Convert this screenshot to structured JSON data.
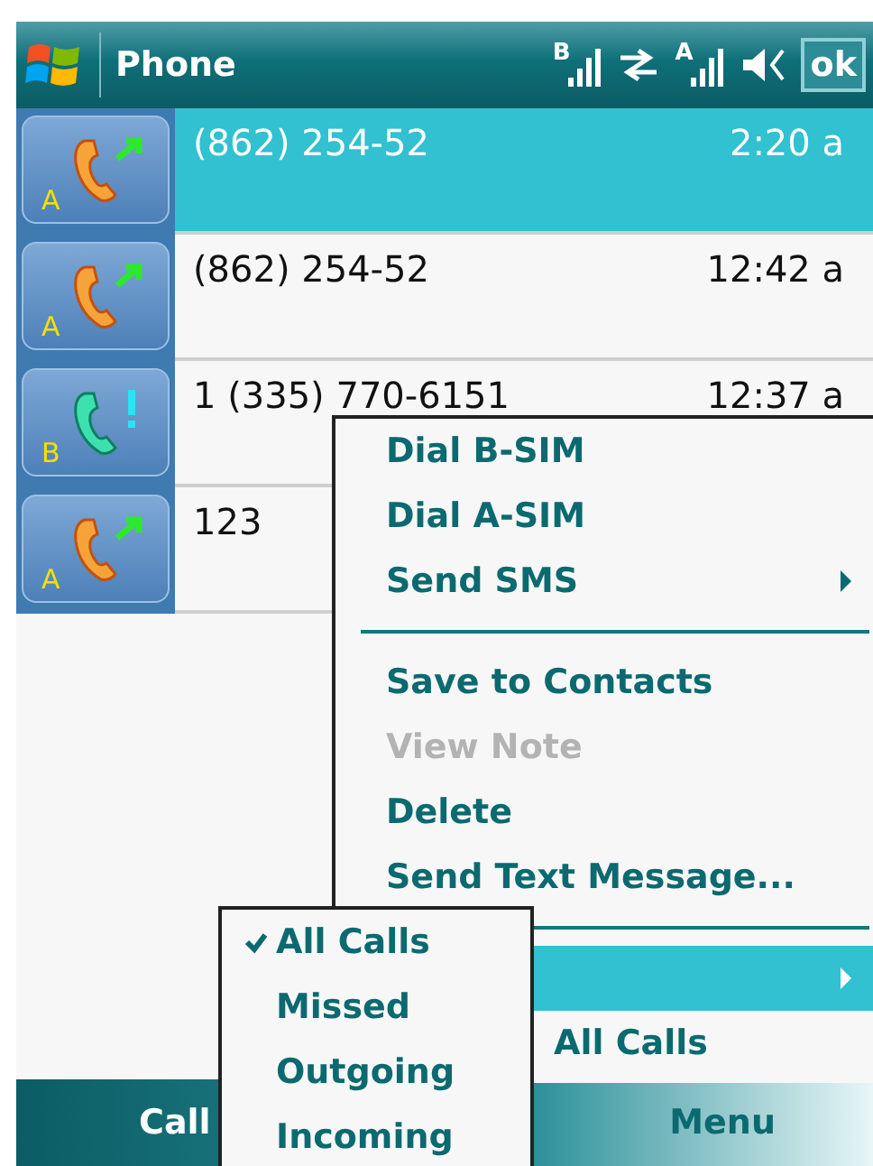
{
  "title_bar": {
    "title": "Phone",
    "signal_b_label": "B",
    "signal_a_label": "A",
    "ok_button": "ok"
  },
  "calls": [
    {
      "number": "(862) 254-52",
      "time": "2:20 a",
      "kind": "outgoing",
      "sim": "A",
      "selected": true
    },
    {
      "number": "(862) 254-52",
      "time": "12:42 a",
      "kind": "outgoing",
      "sim": "A",
      "selected": false
    },
    {
      "number": "1 (335) 770-6151",
      "time": "12:37 a",
      "kind": "missed",
      "sim": "B",
      "selected": false
    },
    {
      "number": "123",
      "kind": "outgoing",
      "sim": "A",
      "selected": false
    }
  ],
  "context_menu": [
    {
      "kind": "item",
      "label": "Dial B-SIM",
      "disabled": false,
      "selected": false,
      "submenu": false
    },
    {
      "kind": "item",
      "label": "Dial A-SIM",
      "disabled": false,
      "selected": false,
      "submenu": false
    },
    {
      "kind": "item",
      "label": "Send SMS",
      "disabled": false,
      "selected": false,
      "submenu": true
    },
    {
      "kind": "separator"
    },
    {
      "kind": "item",
      "label": "Save to Contacts",
      "disabled": false,
      "selected": false,
      "submenu": false
    },
    {
      "kind": "item",
      "label": "View Note",
      "disabled": true,
      "selected": false,
      "submenu": false
    },
    {
      "kind": "item",
      "label": "Delete",
      "disabled": false,
      "selected": false,
      "submenu": false
    },
    {
      "kind": "item",
      "label": "Send Text Message...",
      "disabled": false,
      "selected": false,
      "submenu": false
    },
    {
      "kind": "separator"
    },
    {
      "kind": "item",
      "disabled": false,
      "selected": true,
      "submenu": true
    },
    {
      "kind": "item",
      "label": "All Calls",
      "disabled": false,
      "selected": false,
      "submenu": false
    }
  ],
  "filter_submenu": [
    {
      "label": "All Calls",
      "checked": true
    },
    {
      "label": "Missed",
      "checked": false
    },
    {
      "label": "Outgoing",
      "checked": false
    },
    {
      "label": "Incoming",
      "checked": false
    }
  ],
  "soft_keys": {
    "left": "Call",
    "right": "Menu"
  }
}
